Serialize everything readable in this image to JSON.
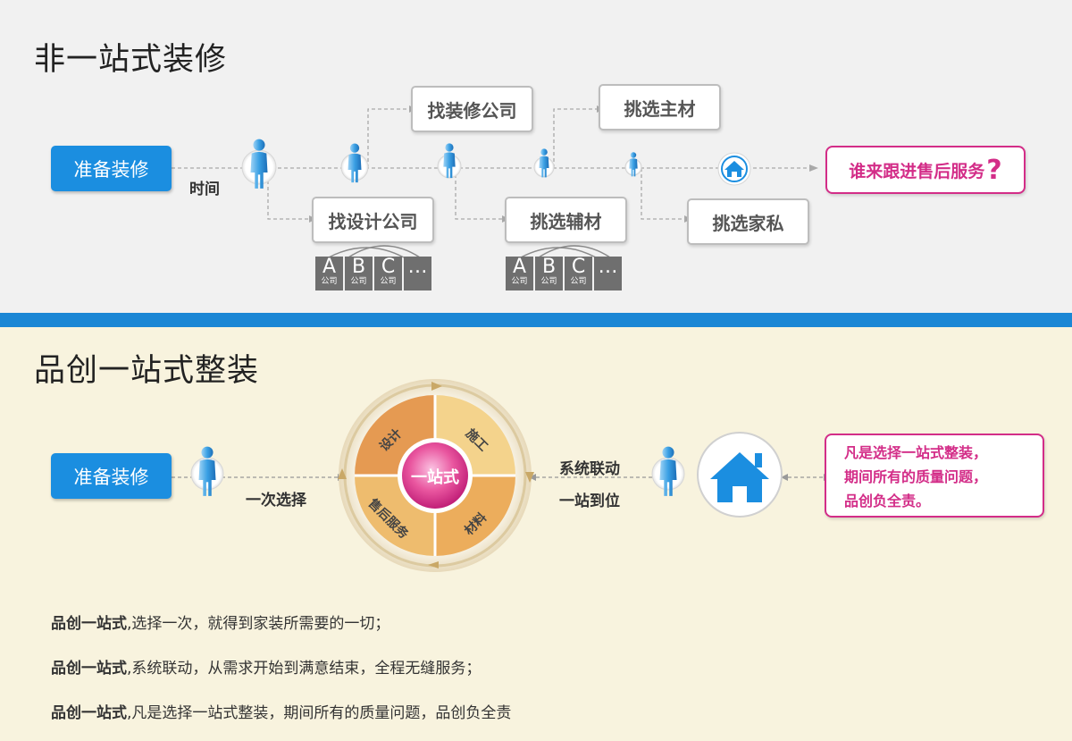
{
  "top": {
    "title": "非一站式装修",
    "start_label": "准备装修",
    "time_label": "时间",
    "steps": {
      "find_decor": "找装修公司",
      "pick_main": "挑选主材",
      "find_design": "找设计公司",
      "pick_aux": "挑选辅材",
      "pick_furniture": "挑选家私"
    },
    "question_box": "谁来跟进售后服务",
    "question_mark": "?",
    "company_tiles": [
      {
        "letter": "A",
        "sub": "公司"
      },
      {
        "letter": "B",
        "sub": "公司"
      },
      {
        "letter": "C",
        "sub": "公司"
      },
      {
        "letter": "…",
        "sub": ""
      }
    ]
  },
  "bottom": {
    "title": "品创一站式整装",
    "start_label": "准备装修",
    "choose_label": "一次选择",
    "link_label_1": "系统联动",
    "link_label_2": "一站到位",
    "center": "一站式",
    "quadrants": {
      "design": "设计",
      "construct": "施工",
      "service": "售后服务",
      "material": "材料"
    },
    "pink_box_lines": [
      "凡是选择一站式整装，",
      "期间所有的质量问题，",
      "品创负全责。"
    ],
    "lines": [
      {
        "bold": "品创一站式",
        "text": ",选择一次，就得到家装所需要的一切；"
      },
      {
        "bold": "品创一站式",
        "text": ",系统联动，从需求开始到满意结束，全程无缝服务；"
      },
      {
        "bold": "品创一站式",
        "text": ",凡是选择一站式整装，期间所有的质量问题，品创负全责"
      }
    ]
  },
  "colors": {
    "blue": "#1b8ee0",
    "pink": "#d32d88",
    "divider": "#1b87d5"
  }
}
